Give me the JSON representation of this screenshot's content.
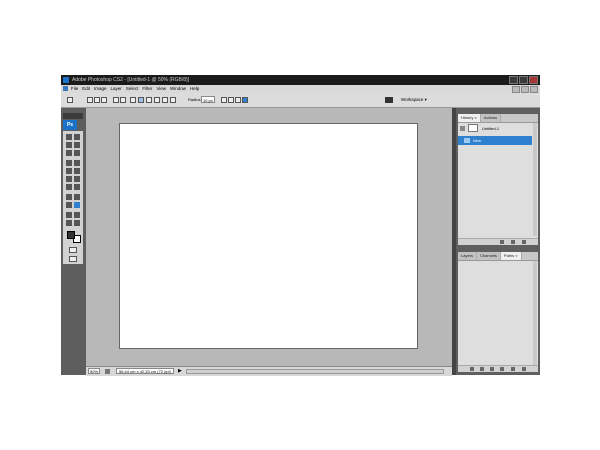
{
  "window": {
    "title": "Adobe Photoshop CS2 - [Untitled-1 @ 50% (RGB/8)]"
  },
  "menu": {
    "items": [
      "File",
      "Edit",
      "Image",
      "Layer",
      "Select",
      "Filter",
      "View",
      "Window",
      "Help"
    ]
  },
  "options_bar": {
    "radius_label": "Radius:",
    "radius_value": "10 px",
    "workspace_label": "Workspace ▾"
  },
  "toolbox": {
    "logo": "Ps"
  },
  "status": {
    "zoom": "50%",
    "doc_size": "56,44 cm x 42,33 cm (72 ppi)",
    "arrow": "▶"
  },
  "history_panel": {
    "tabs": [
      "History ×",
      "Actions"
    ],
    "snapshot_label": "Untitled-1",
    "state_label": "New"
  },
  "layers_panel": {
    "tabs": [
      "Layers",
      "Channels",
      "Paths ×"
    ]
  },
  "colors": {
    "accent": "#2f80cf",
    "canvas": "#ffffff",
    "doc_background": "#b8b8b8",
    "chrome_dark": "#4a4a4a"
  }
}
